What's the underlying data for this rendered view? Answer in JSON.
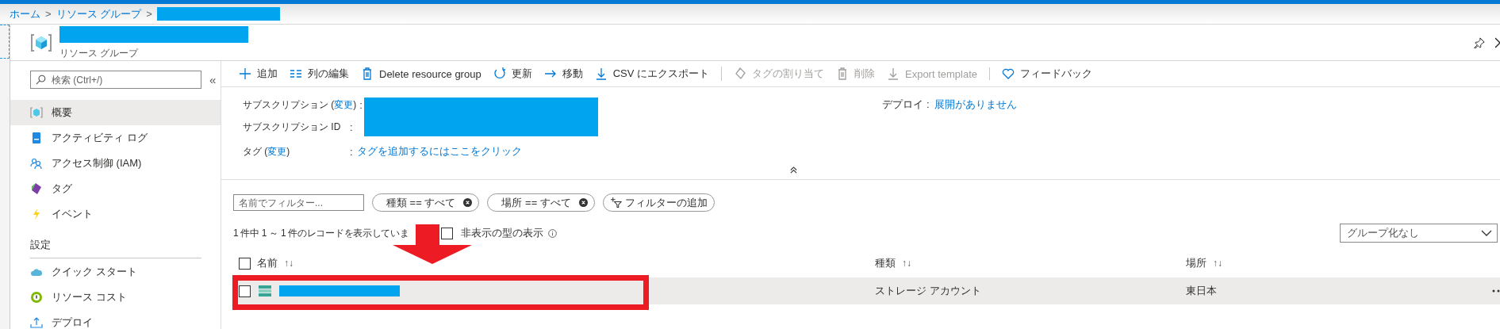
{
  "breadcrumb": [
    {
      "label": "ホーム",
      "separator": ">"
    },
    {
      "label": "リソース グループ",
      "separator": ">"
    }
  ],
  "header": {
    "subtitle": "リソース グループ"
  },
  "sidebar": {
    "search_placeholder": "検索 (Ctrl+/)",
    "collapse": "«",
    "sections": [
      {
        "items": [
          {
            "label": "概要",
            "selected": true
          },
          {
            "label": "アクティビティ ログ",
            "selected": false
          },
          {
            "label": "アクセス制御 (IAM)",
            "selected": false
          },
          {
            "label": "タグ",
            "selected": false
          },
          {
            "label": "イベント",
            "selected": false
          }
        ]
      },
      {
        "title": "設定",
        "items": [
          {
            "label": "クイック スタート",
            "selected": false
          },
          {
            "label": "リソース コスト",
            "selected": false
          },
          {
            "label": "デプロイ",
            "selected": false
          }
        ]
      }
    ]
  },
  "toolbar": [
    {
      "label": "追加",
      "disabled": false,
      "separator_after": false
    },
    {
      "label": "列の編集",
      "disabled": false,
      "separator_after": false
    },
    {
      "label": "Delete resource group",
      "disabled": false,
      "separator_after": false
    },
    {
      "label": "更新",
      "disabled": false,
      "separator_after": false
    },
    {
      "label": "移動",
      "disabled": false,
      "separator_after": false
    },
    {
      "label": "CSV にエクスポート",
      "disabled": false,
      "separator_after": true
    },
    {
      "label": "タグの割り当て",
      "disabled": true,
      "separator_after": false
    },
    {
      "label": "削除",
      "disabled": true,
      "separator_after": false
    },
    {
      "label": "Export template",
      "disabled": true,
      "separator_after": true
    },
    {
      "label": "フィードバック",
      "disabled": false,
      "separator_after": false
    }
  ],
  "essentials": {
    "rows": [
      {
        "label_before": "サブスクリプション (",
        "link": "変更",
        "label_after": ")",
        "colon": ":"
      },
      {
        "label_before": "サブスクリプション ID",
        "colon": ":"
      },
      {
        "label_before": "タグ (",
        "link": "変更",
        "label_after": ")",
        "colon": ":",
        "value_link": "タグを追加するにはここをクリック"
      }
    ],
    "deploy": {
      "label": "デプロイ :",
      "value_link": "展開がありません"
    }
  },
  "filters": {
    "placeholder": "名前でフィルター...",
    "pills": [
      {
        "label": "種類 == すべて"
      },
      {
        "label": "場所 == すべて"
      }
    ],
    "add_filter": "フィルターの追加"
  },
  "records": {
    "summary": "1 件中 1 ～ 1 件のレコードを表示していま",
    "show_hidden": {
      "label": "非表示の型の表示",
      "checked": false
    },
    "grouping": "グループ化なし"
  },
  "table": {
    "all_checked": false,
    "columns": [
      {
        "label": "名前",
        "sort": "↑↓"
      },
      {
        "label": "種類",
        "sort": "↑↓"
      },
      {
        "label": "場所",
        "sort": "↑↓"
      }
    ],
    "rows": [
      {
        "checked": false,
        "selected": true,
        "type": "ストレージ アカウント",
        "location": "東日本"
      }
    ]
  }
}
